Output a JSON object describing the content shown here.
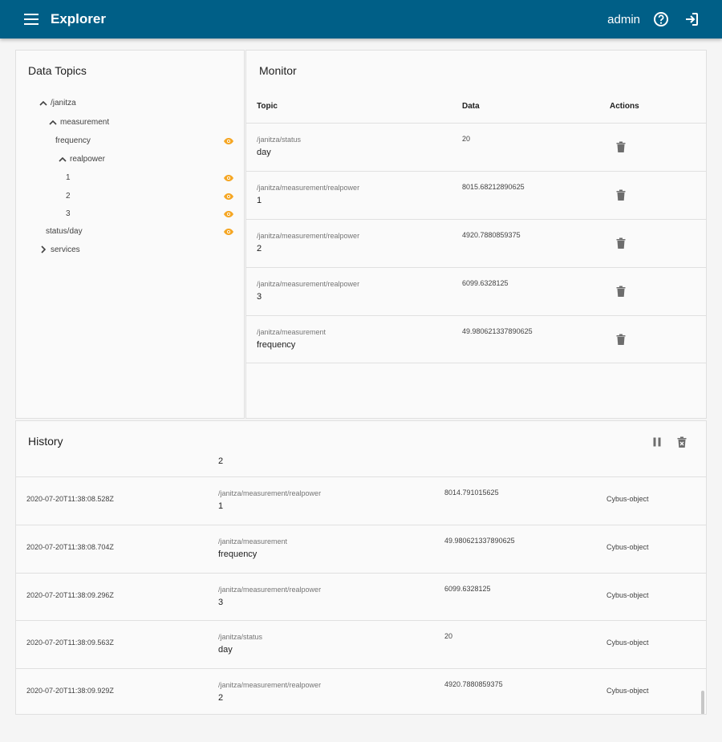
{
  "colors": {
    "brand": "#005f87",
    "accent": "#f5a623",
    "icon_gray": "#6d6d6d"
  },
  "appbar": {
    "title": "Explorer",
    "user": "admin",
    "menu_icon": "menu-icon",
    "help_icon": "help-icon",
    "logout_icon": "logout-icon"
  },
  "topics": {
    "title": "Data Topics",
    "tree": [
      {
        "label": "/janitza",
        "chevron": "up"
      },
      {
        "label": "measurement",
        "chevron": "up"
      },
      {
        "label": "frequency",
        "eye": true
      },
      {
        "label": "realpower",
        "chevron": "up"
      },
      {
        "label": "1",
        "eye": true
      },
      {
        "label": "2",
        "eye": true
      },
      {
        "label": "3",
        "eye": true
      },
      {
        "label": "status/day",
        "eye": true
      },
      {
        "label": "services",
        "chevron": "right"
      }
    ]
  },
  "monitor": {
    "title": "Monitor",
    "columns": [
      "Topic",
      "Data",
      "Actions"
    ],
    "rows": [
      {
        "path": "/janitza/status",
        "leaf": "day",
        "data": "20"
      },
      {
        "path": "/janitza/measurement/realpower",
        "leaf": "1",
        "data": "8015.68212890625"
      },
      {
        "path": "/janitza/measurement/realpower",
        "leaf": "2",
        "data": "4920.7880859375"
      },
      {
        "path": "/janitza/measurement/realpower",
        "leaf": "3",
        "data": "6099.6328125"
      },
      {
        "path": "/janitza/measurement",
        "leaf": "frequency",
        "data": "49.980621337890625"
      }
    ]
  },
  "history": {
    "title": "History",
    "partial_leaf": "2",
    "rows": [
      {
        "timestamp": "2020-07-20T11:38:08.528Z",
        "path": "/janitza/measurement/realpower",
        "leaf": "1",
        "data": "8014.791015625",
        "source": "Cybus-object"
      },
      {
        "timestamp": "2020-07-20T11:38:08.704Z",
        "path": "/janitza/measurement",
        "leaf": "frequency",
        "data": "49.980621337890625",
        "source": "Cybus-object"
      },
      {
        "timestamp": "2020-07-20T11:38:09.296Z",
        "path": "/janitza/measurement/realpower",
        "leaf": "3",
        "data": "6099.6328125",
        "source": "Cybus-object"
      },
      {
        "timestamp": "2020-07-20T11:38:09.563Z",
        "path": "/janitza/status",
        "leaf": "day",
        "data": "20",
        "source": "Cybus-object"
      },
      {
        "timestamp": "2020-07-20T11:38:09.929Z",
        "path": "/janitza/measurement/realpower",
        "leaf": "2",
        "data": "4920.7880859375",
        "source": "Cybus-object"
      }
    ]
  }
}
